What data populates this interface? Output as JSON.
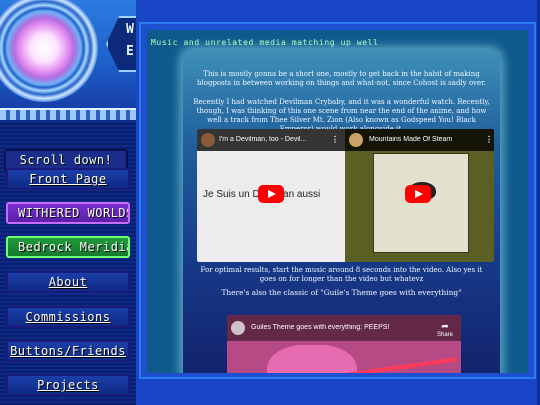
{
  "sidebar": {
    "logo_letters": [
      "W",
      "E"
    ],
    "nav_items": [
      {
        "id": "scroll",
        "label": "Scroll down!"
      },
      {
        "id": "front",
        "label": "Front Page"
      },
      {
        "id": "withered",
        "label": "WITHERED WORLDS"
      },
      {
        "id": "bedrock",
        "label": "Bedrock Meridian"
      },
      {
        "id": "about",
        "label": "About"
      },
      {
        "id": "commissions",
        "label": "Commissions"
      },
      {
        "id": "buttons",
        "label": "Buttons/Friends"
      },
      {
        "id": "projects",
        "label": "Projects"
      }
    ]
  },
  "post": {
    "tab_title": "Music and unrelated media matching up well",
    "paragraph_1": "This is mostly gonna be a short one, mostly to get back in the habit of making blogposts in between working on things and what-not, since Cohost is sadly over.",
    "paragraph_2": "Recently I had watched Devilman Crybaby, and it was a wonderful watch. Recently, though, I was thinking of this one scene from near the end of the anime, and how well a track from Thee Silver Mt. Zion (Also known as Godspeed You! Black Emperor) would work alongside it.",
    "paragraph_3": "For optimal results, start the music around 8 seconds into the video. Also yes it goes on for longer than the video but whatevz",
    "paragraph_4": "There's also the classic of \"Guile's Theme goes with everything\"",
    "video_1": {
      "left_title": "I'm a Devilman, too - Devil...",
      "left_overlay_text": "Je Suis un Devilman aussi",
      "right_title": "Mountains Made Of Steam"
    },
    "video_2": {
      "title": "Guiles Theme goes with everything: PEEPS!",
      "share_label": "Share"
    }
  },
  "colors": {
    "page_bg": "#1846c6",
    "youtube_red": "#ff0000",
    "tab_title_green": "#b8ffb8"
  }
}
